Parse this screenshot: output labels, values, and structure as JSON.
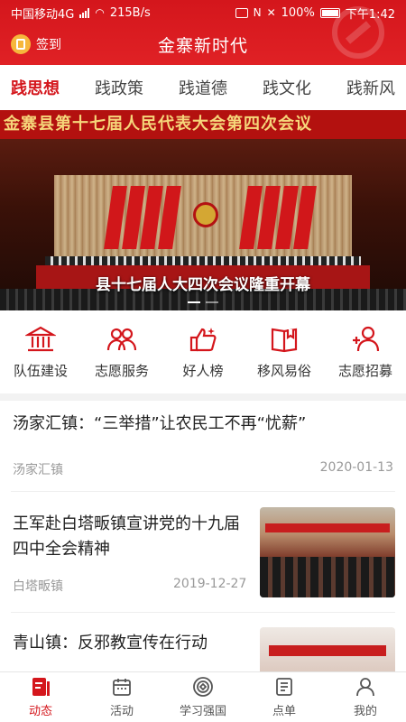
{
  "status_bar": {
    "carrier": "中国移动4G",
    "network_speed": "215B/s",
    "battery": "100%",
    "time": "下午1:42"
  },
  "header": {
    "checkin_label": "签到",
    "title": "金寨新时代"
  },
  "tabs": [
    {
      "label": "践思想",
      "active": true
    },
    {
      "label": "践政策",
      "active": false
    },
    {
      "label": "践道德",
      "active": false
    },
    {
      "label": "践文化",
      "active": false
    },
    {
      "label": "践新风",
      "active": false
    }
  ],
  "banner": {
    "top_text": "金寨县第十七届人民代表大会第四次会议",
    "caption": "县十七届人大四次会议隆重开幕"
  },
  "quick_entries": [
    {
      "label": "队伍建设",
      "icon": "institution-icon"
    },
    {
      "label": "志愿服务",
      "icon": "volunteer-group-icon"
    },
    {
      "label": "好人榜",
      "icon": "thumbs-up-icon"
    },
    {
      "label": "移风易俗",
      "icon": "book-icon"
    },
    {
      "label": "志愿招募",
      "icon": "add-user-icon"
    }
  ],
  "news": [
    {
      "title": "汤家汇镇：“三举措”让农民工不再“忧薪”",
      "source": "汤家汇镇",
      "date": "2020-01-13"
    },
    {
      "title": "王军赴白塔畈镇宣讲党的十九届四中全会精神",
      "source": "白塔畈镇",
      "date": "2019-12-27"
    },
    {
      "title": "青山镇：反邪教宣传在行动",
      "source": "",
      "date": ""
    }
  ],
  "bottom_nav": [
    {
      "label": "动态",
      "active": true
    },
    {
      "label": "活动",
      "active": false
    },
    {
      "label": "学习强国",
      "active": false
    },
    {
      "label": "点单",
      "active": false
    },
    {
      "label": "我的",
      "active": false
    }
  ],
  "colors": {
    "brand_red": "#d4161c"
  }
}
